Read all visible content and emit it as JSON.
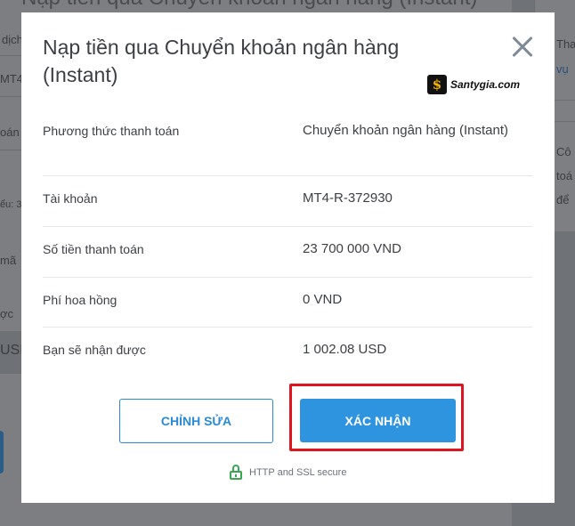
{
  "background": {
    "top_title": "Nạp tiền qua Chuyển khoản ngân hàng (Instant)",
    "left_fragments": [
      "dịch",
      "MT4",
      "oán",
      "ểu: 3",
      "mã",
      "ợc",
      "USI"
    ],
    "right_fragments": [
      "Tha",
      "vụ",
      "Cô",
      "toá",
      "để"
    ]
  },
  "modal": {
    "title": "Nạp tiền qua Chuyển khoản ngân hàng (Instant)",
    "watermark": "Santygia.com",
    "rows": [
      {
        "label": "Phương thức thanh toán",
        "value": "Chuyển khoản ngân hàng (Instant)"
      },
      {
        "label": "Tài khoản",
        "value": "MT4-R-372930"
      },
      {
        "label": "Số tiền thanh toán",
        "value": "23 700 000 VND"
      },
      {
        "label": "Phí hoa hồng",
        "value": "0 VND"
      },
      {
        "label": "Bạn sẽ nhận được",
        "value": "1 002.08 USD"
      }
    ],
    "edit_label": "CHỈNH SỬA",
    "confirm_label": "XÁC NHẬN",
    "secure_text": "HTTP and SSL secure"
  },
  "colors": {
    "accent": "#2f94df",
    "highlight": "#e0141e",
    "secure": "#3aa852"
  }
}
